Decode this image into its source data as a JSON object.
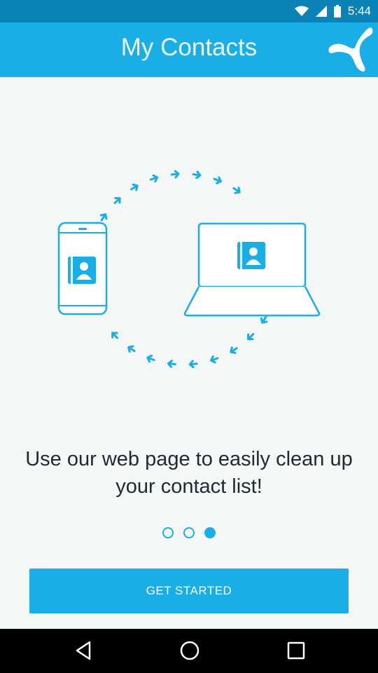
{
  "status_bar": {
    "time": "5:44",
    "icons": [
      "wifi-icon",
      "cellular-signal-icon",
      "battery-icon"
    ]
  },
  "app_bar": {
    "title": "My Contacts",
    "logo_icon": "telenor-logo-icon",
    "color": "#19aee6"
  },
  "illustration": {
    "icons": [
      "phone-contacts-icon",
      "laptop-contacts-icon",
      "sync-arrows-icon"
    ]
  },
  "onboarding": {
    "message": "Use our web page to easily clean up your contact list!",
    "pages": 3,
    "current_page": 3
  },
  "cta": {
    "label": "GET STARTED"
  },
  "nav_bar": {
    "icons": [
      "back-icon",
      "home-icon",
      "recents-icon"
    ]
  }
}
